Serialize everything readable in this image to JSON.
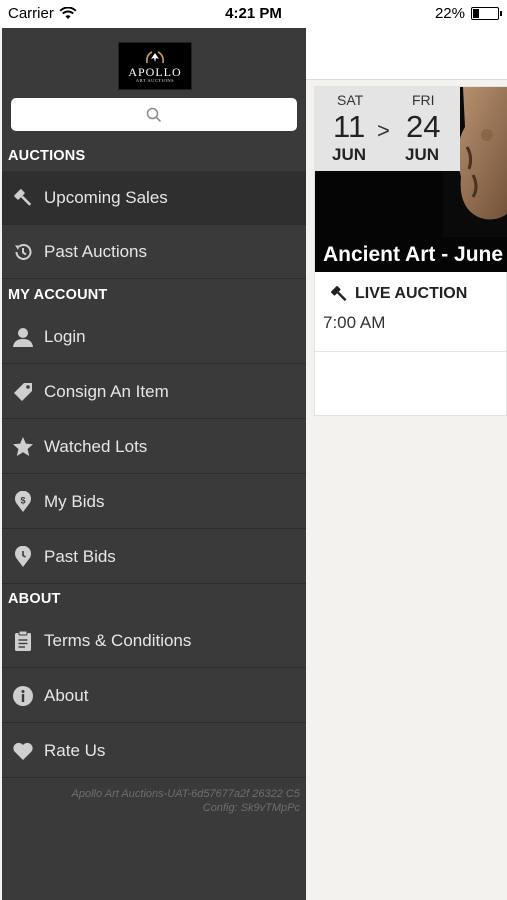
{
  "status_bar": {
    "carrier": "Carrier",
    "time": "4:21 PM",
    "battery": "22%",
    "battery_level": 0.22
  },
  "brand": {
    "logo_name": "APOLLO",
    "logo_sub": "ART AUCTIONS"
  },
  "search": {
    "placeholder": ""
  },
  "menu": {
    "auctions_header": "AUCTIONS",
    "auctions": [
      {
        "label": "Upcoming Sales",
        "icon": "gavel-icon"
      },
      {
        "label": "Past Auctions",
        "icon": "history-icon"
      }
    ],
    "account_header": "MY ACCOUNT",
    "account": [
      {
        "label": "Login",
        "icon": "user-icon"
      },
      {
        "label": "Consign An Item",
        "icon": "tag-icon"
      },
      {
        "label": "Watched Lots",
        "icon": "star-icon"
      },
      {
        "label": "My Bids",
        "icon": "dollar-pin-icon"
      },
      {
        "label": "Past Bids",
        "icon": "clock-pin-icon"
      }
    ],
    "about_header": "ABOUT",
    "about": [
      {
        "label": "Terms & Conditions",
        "icon": "clipboard-icon"
      },
      {
        "label": "About",
        "icon": "info-icon"
      },
      {
        "label": "Rate Us",
        "icon": "heart-icon"
      }
    ],
    "footer_line1": "Apollo Art Auctions-UAT-6d57677a2f 26322 C5",
    "footer_line2": "Config: Sk9vTMpPc"
  },
  "auction_card": {
    "start_dow": "SAT",
    "start_day": "11",
    "start_month": "JUN",
    "separator": ">",
    "end_dow": "FRI",
    "end_day": "24",
    "end_month": "JUN",
    "title": "Ancient Art - June",
    "type": "LIVE AUCTION",
    "time": "7:00 AM"
  },
  "colors": {
    "drawer_bg": "#3a3a3a",
    "content_bg": "#f3f2ee",
    "card_hero_bg": "#050505"
  }
}
